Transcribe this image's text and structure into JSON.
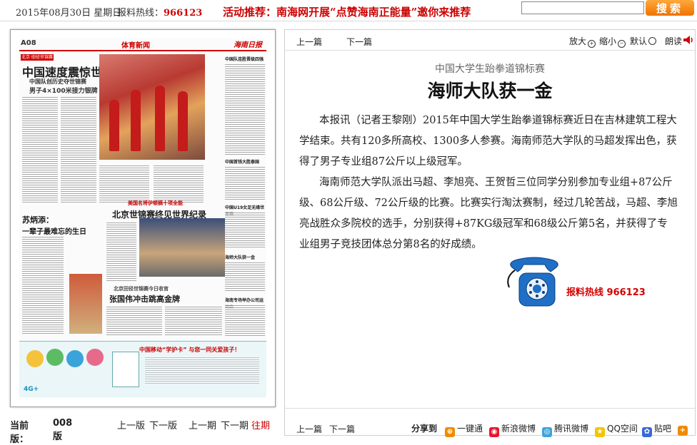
{
  "topbar": {
    "date": "2015年08月30日 星期日",
    "hotline_label": "报料热线：",
    "hotline_number": "966123",
    "promo": "活动推荐：南海网开展“点赞海南正能量”邀你来推荐",
    "search_value": "",
    "search_button": "搜索"
  },
  "paper": {
    "page_no": "A08",
    "section": "体育新闻",
    "logo": "海南日报",
    "tag": "北京·田径世锦赛",
    "headline": "中国速度震惊世界",
    "sub1": "中国队创历史夺世锦赛",
    "sub2": "男子4×100米接力银牌",
    "mid_kicker": "美国名将伊顿摘十项全能",
    "mid_headline": "北京世锦赛终见世界纪录",
    "side_headline1": "苏炳添：",
    "side_headline2": "一辈子最难忘的生日",
    "lower_kicker": "北京田径世锦赛今日收官",
    "lower_headline": "张国伟冲击跳高金牌",
    "col_heads": [
      "中国队连胜晋级四强",
      "中国首钱大胜泰国",
      "中国U19女足无缘世青赛",
      "海师大队获一金",
      "海南专场举办公司运动会"
    ],
    "ad_title": "中国移动“学护卡” 与您一同关爱孩子！",
    "ad_logo": "4G+"
  },
  "paper_nav": {
    "current_label": "当前版：",
    "current_value": "008版",
    "prev_page": "上一版",
    "next_page": "下一版",
    "prev_issue": "上一期",
    "next_issue": "下一期",
    "past_issues": "往期"
  },
  "article": {
    "prev": "上一篇",
    "next": "下一篇",
    "zoom_in": "放大",
    "zoom_out": "缩小",
    "default": "默认",
    "read": "朗读",
    "kicker": "中国大学生跆拳道锦标赛",
    "title": "海师大队获一金",
    "paragraphs": [
      "本报讯（记者王黎刚）2015年中国大学生跆拳道锦标赛近日在吉林建筑工程大学结束。共有120多所高校、1300多人参赛。海南师范大学队的马超发挥出色，获得了男子专业组87公斤以上级冠军。",
      "海南师范大学队派出马超、李旭亮、王贺哲三位同学分别参加专业组+87公斤级、68公斤级、72公斤级的比赛。比赛实行淘汰赛制，经过几轮苦战，马超、李旭亮战胜众多院校的选手，分别获得+87KG级冠军和68级公斤第5名，并获得了专业组男子竞技团体总分第8名的好成绩。"
    ],
    "hotline": "报料热线  966123",
    "bottom_prev": "上一篇",
    "bottom_next": "下一篇",
    "share_label": "分享到",
    "share_items": [
      "一键通",
      "新浪微博",
      "腾讯微博",
      "QQ空间",
      "贴吧"
    ]
  },
  "colors": {
    "accent_red": "#cc0000",
    "search_orange": "#ee7300",
    "phone_blue": "#1f6fc6"
  }
}
